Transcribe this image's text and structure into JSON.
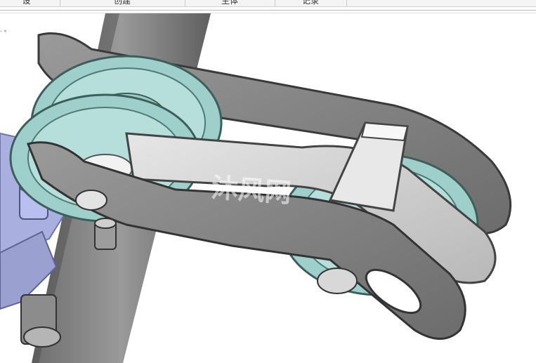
{
  "menu": {
    "tabs": [
      "设",
      "创建",
      "主体",
      "记录"
    ]
  },
  "viewport": {
    "corner_mark": ". 。",
    "watermark": "沐风网"
  },
  "colors": {
    "background": "#ffffff",
    "frame_gray": "#8a8a8a",
    "plate_light": "#c4c4c4",
    "sprocket_teal": "#b6dedb",
    "sprocket_dark": "#7fb5b1"
  }
}
